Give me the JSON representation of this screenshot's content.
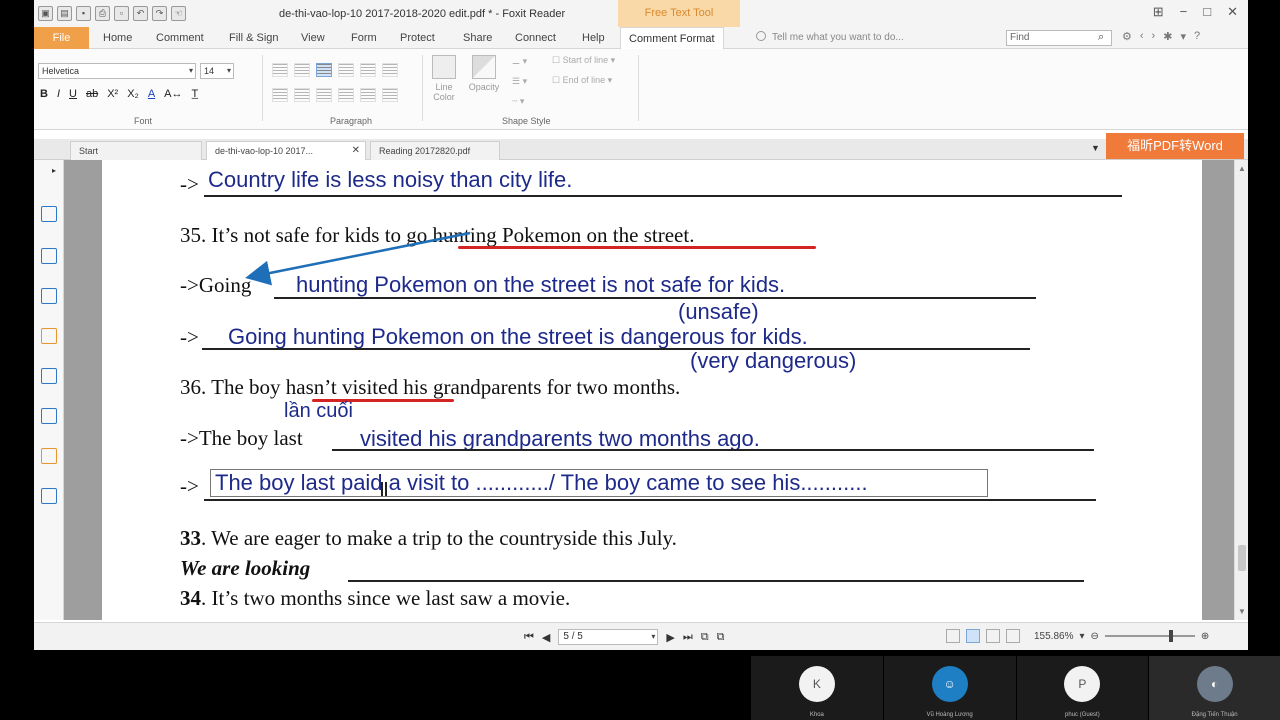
{
  "window": {
    "title": "de-thi-vao-lop-10 2017-2018-2020 edit.pdf * - Foxit Reader",
    "context_tab_header": "Free Text Tool"
  },
  "menu": {
    "file": "File",
    "tabs": [
      "Home",
      "Comment",
      "Fill & Sign",
      "View",
      "Form",
      "Protect",
      "Share",
      "Connect",
      "Help",
      "Comment Format"
    ],
    "tell_me": "Tell me what you want to do...",
    "find_placeholder": "Find"
  },
  "ribbon": {
    "font": "Helvetica",
    "size": "14",
    "groups": [
      "Font",
      "Paragraph",
      "Shape Style"
    ],
    "line_color": "Line Color",
    "opacity": "Opacity",
    "start_of_line": "Start of line",
    "end_of_line": "End of line"
  },
  "doc_tabs": [
    "Start",
    "de-thi-vao-lop-10 2017...",
    "Reading 20172820.pdf"
  ],
  "convert_button": "福昕PDF转Word",
  "document": {
    "l1_prefix": "->",
    "l1_hand": "Country life is less noisy than city life.",
    "q35": "35. It’s not safe for kids to go hunting Pokemon on the street.",
    "going_prefix": "->Going",
    "going_hand": "hunting Pokemon on the street is not safe for kids.",
    "unsafe": "(unsafe)",
    "arrow_prefix": "->",
    "going2_hand": "Going hunting Pokemon on the street is dangerous for kids.",
    "very_dangerous": "(very dangerous)",
    "q36": "36. The boy hasn’t visited his grandparents for two months.",
    "lan_cuoi": "lần cuối",
    "boy_last_prefix": "->The boy last",
    "boy_last_hand": "visited his grandparents two months ago.",
    "arrow2_prefix": "->",
    "textbox": "The boy last paid a visit to ............/ The boy came to see his...........",
    "q33_num": "33",
    "q33_text": ". We are eager to make a trip to the countryside this July.",
    "looking": "We are looking",
    "q34_num": "34",
    "q34_text": ". It’s two months since we last saw a movie."
  },
  "statusbar": {
    "page": "5 / 5",
    "zoom": "155.86%"
  },
  "participants": [
    {
      "initial": "K",
      "name": "Khoa"
    },
    {
      "initial": "",
      "name": "Vũ Hoàng Lương"
    },
    {
      "initial": "P",
      "name": "phuc (Guest)"
    },
    {
      "initial": "",
      "name": "Đặng Tiến Thuận"
    }
  ],
  "colors": {
    "accent_orange": "#f0a048",
    "handwriting_blue": "#1e2a8a",
    "underline_red": "#d32323",
    "arrow_blue": "#1f6fb8"
  }
}
